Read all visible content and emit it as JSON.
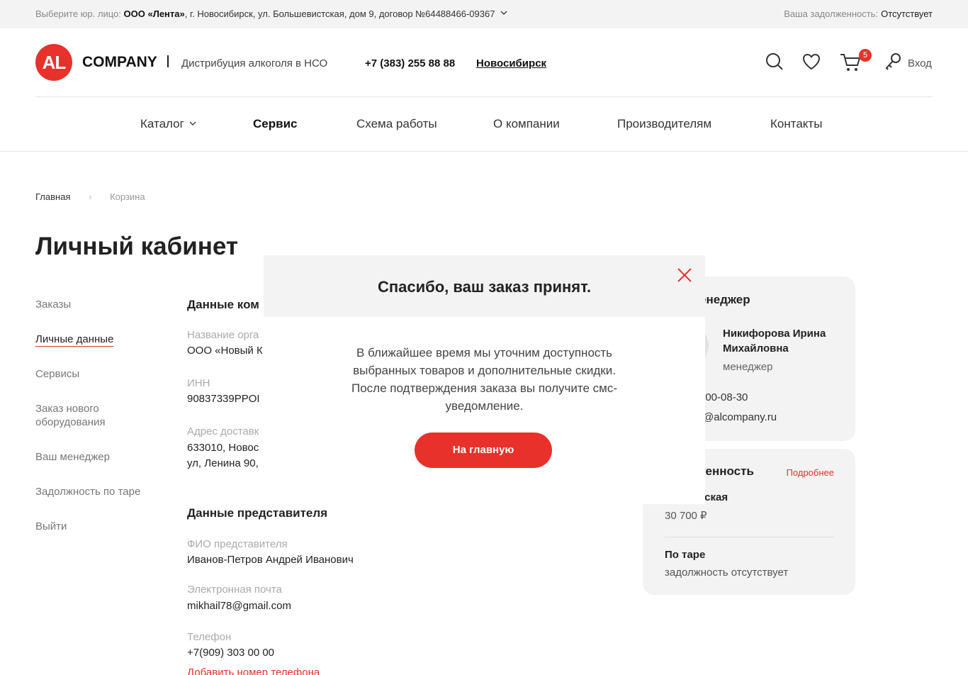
{
  "topbar": {
    "entity_label": "Выберите юр. лицо:",
    "entity_name": "ООО «Лента»",
    "entity_details": ", г. Новосибирск, ул. Большевистская, дом 9, договор №64488466-09367",
    "debt_label": "Ваша задолженность:",
    "debt_value": "Отсутствует"
  },
  "header": {
    "logo_mark": "AL",
    "logo_text": "COMPANY",
    "tagline": "Дистрибуция алкоголя в НСО",
    "phone": "+7 (383) 255 88 88",
    "city": "Новосибирск",
    "cart_count": "5",
    "login_label": "Вход"
  },
  "nav": {
    "items": [
      "Каталог",
      "Сервис",
      "Схема работы",
      "О компании",
      "Производителям",
      "Контакты"
    ],
    "active": "Сервис"
  },
  "breadcrumbs": {
    "home": "Главная",
    "current": "Корзина"
  },
  "page_title": "Личный кабинет",
  "sidebar": {
    "items": [
      "Заказы",
      "Личные данные",
      "Сервисы",
      "Заказ нового оборудования",
      "Ваш менеджер",
      "Задолжность по таре",
      "Выйти"
    ],
    "active": "Личные данные"
  },
  "company_section": {
    "title": "Данные ком",
    "org_label": "Название орга",
    "org_value": "ООО «Новый К",
    "inn_label": "ИНН",
    "inn_value": "90837339PPOI",
    "address_label": "Адрес доставк",
    "address_line1": "633010, Новос",
    "address_line2": "ул, Ленина 90,"
  },
  "rep_section": {
    "title": "Данные представителя",
    "name_label": "ФИО представителя",
    "name_value": "Иванов-Петров Андрей Иванович",
    "email_label": "Электронная почта",
    "email_value": "mikhail78@gmail.com",
    "phone_label": "Телефон",
    "phone_value": "+7(909) 303 00 00",
    "add_phone": "Добавить номер телефона"
  },
  "manager_card": {
    "title": "енеджер",
    "name": "Никифорова Ирина Михайловна",
    "role": "менеджер",
    "phone": "900-08-30",
    "email": ")@alcompany.ru"
  },
  "debt_card": {
    "title": "кенность",
    "more": "Подробнее",
    "row1_title": "рская",
    "row1_value": "30 700 ₽",
    "row2_title": "По таре",
    "row2_value": "задолжность отсутствует"
  },
  "modal": {
    "title": "Спасибо, ваш заказ принят.",
    "text": "В ближайшее время мы уточним доступность выбранных товаров и дополнительные скидки. После подтверждения заказа вы получите смс-уведомление.",
    "button": "На главную"
  },
  "colors": {
    "accent": "#e8312a",
    "panel": "#f3f3f3"
  }
}
